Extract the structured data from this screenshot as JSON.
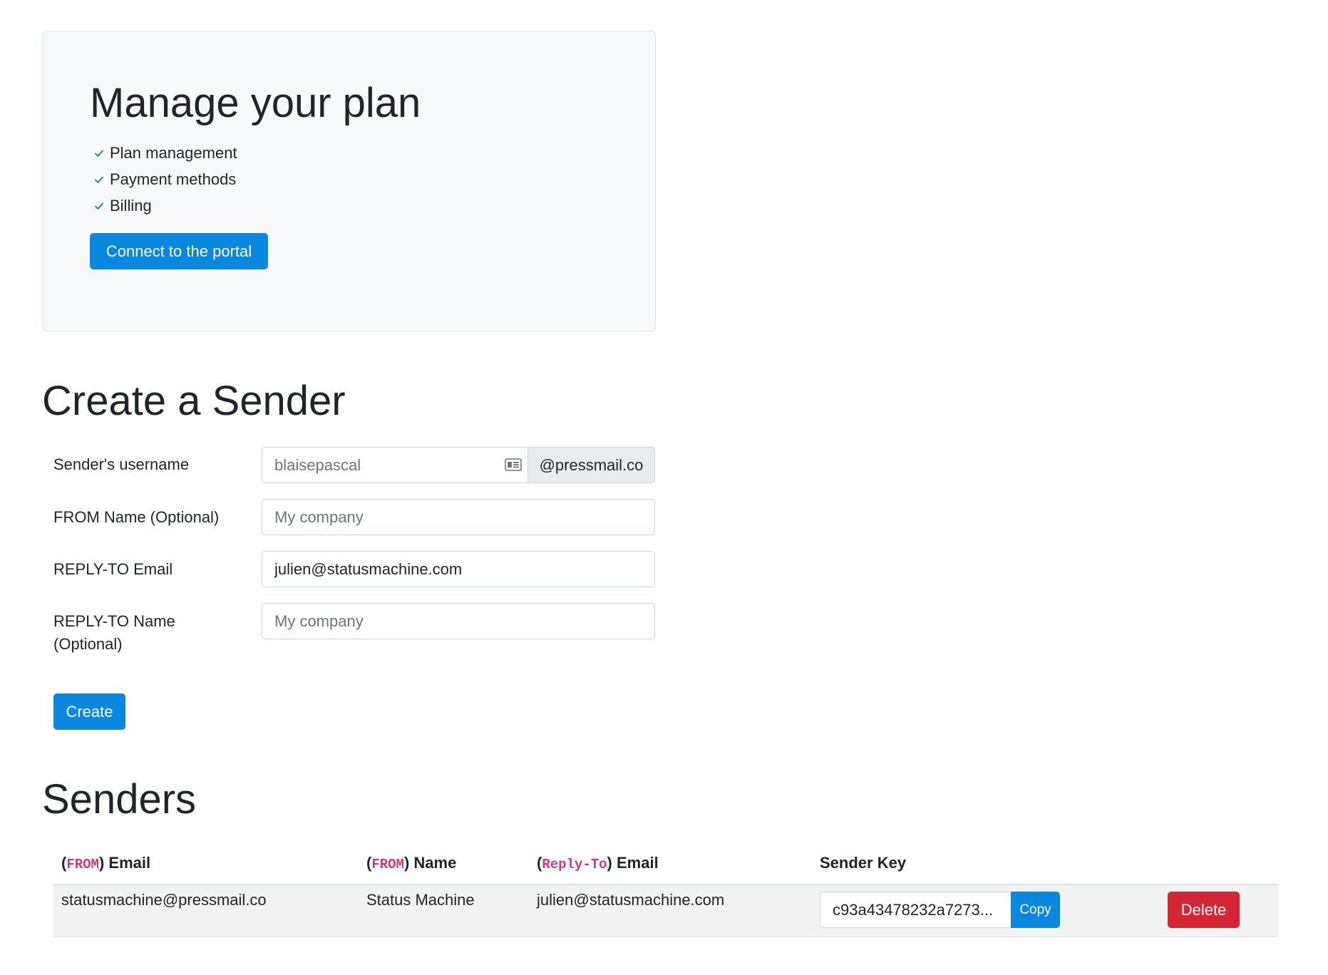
{
  "plan": {
    "title": "Manage your plan",
    "features": [
      "Plan management",
      "Payment methods",
      "Billing"
    ],
    "portal_button": "Connect to the portal"
  },
  "create_sender": {
    "title": "Create a Sender",
    "username_label": "Sender's username",
    "username_placeholder": "blaisepascal",
    "domain_suffix": "@pressmail.co",
    "from_name_label": "FROM Name (Optional)",
    "from_name_placeholder": "My company",
    "reply_to_email_label": "REPLY-TO Email",
    "reply_to_email_value": "julien@statusmachine.com",
    "reply_to_name_label_line1": "REPLY-TO Name",
    "reply_to_name_label_line2": "(Optional)",
    "reply_to_name_placeholder": "My company",
    "create_button": "Create"
  },
  "senders": {
    "title": "Senders",
    "columns": {
      "from_email": {
        "code": "FROM",
        "label": "Email"
      },
      "from_name": {
        "code": "FROM",
        "label": "Name"
      },
      "reply_to_email": {
        "code": "Reply-To",
        "label": "Email"
      },
      "sender_key": "Sender Key"
    },
    "rows": [
      {
        "from_email": "statusmachine@pressmail.co",
        "from_name": "Status Machine",
        "reply_to_email": "julien@statusmachine.com",
        "sender_key": "c93a43478232a7273...",
        "copy_label": "Copy",
        "delete_label": "Delete"
      }
    ]
  },
  "colors": {
    "primary": "#0a87df",
    "danger": "#d42534",
    "check": "#198754",
    "code": "#d63384"
  },
  "icons": {
    "feature_check": "check-icon",
    "username_field": "contact-card-icon"
  }
}
